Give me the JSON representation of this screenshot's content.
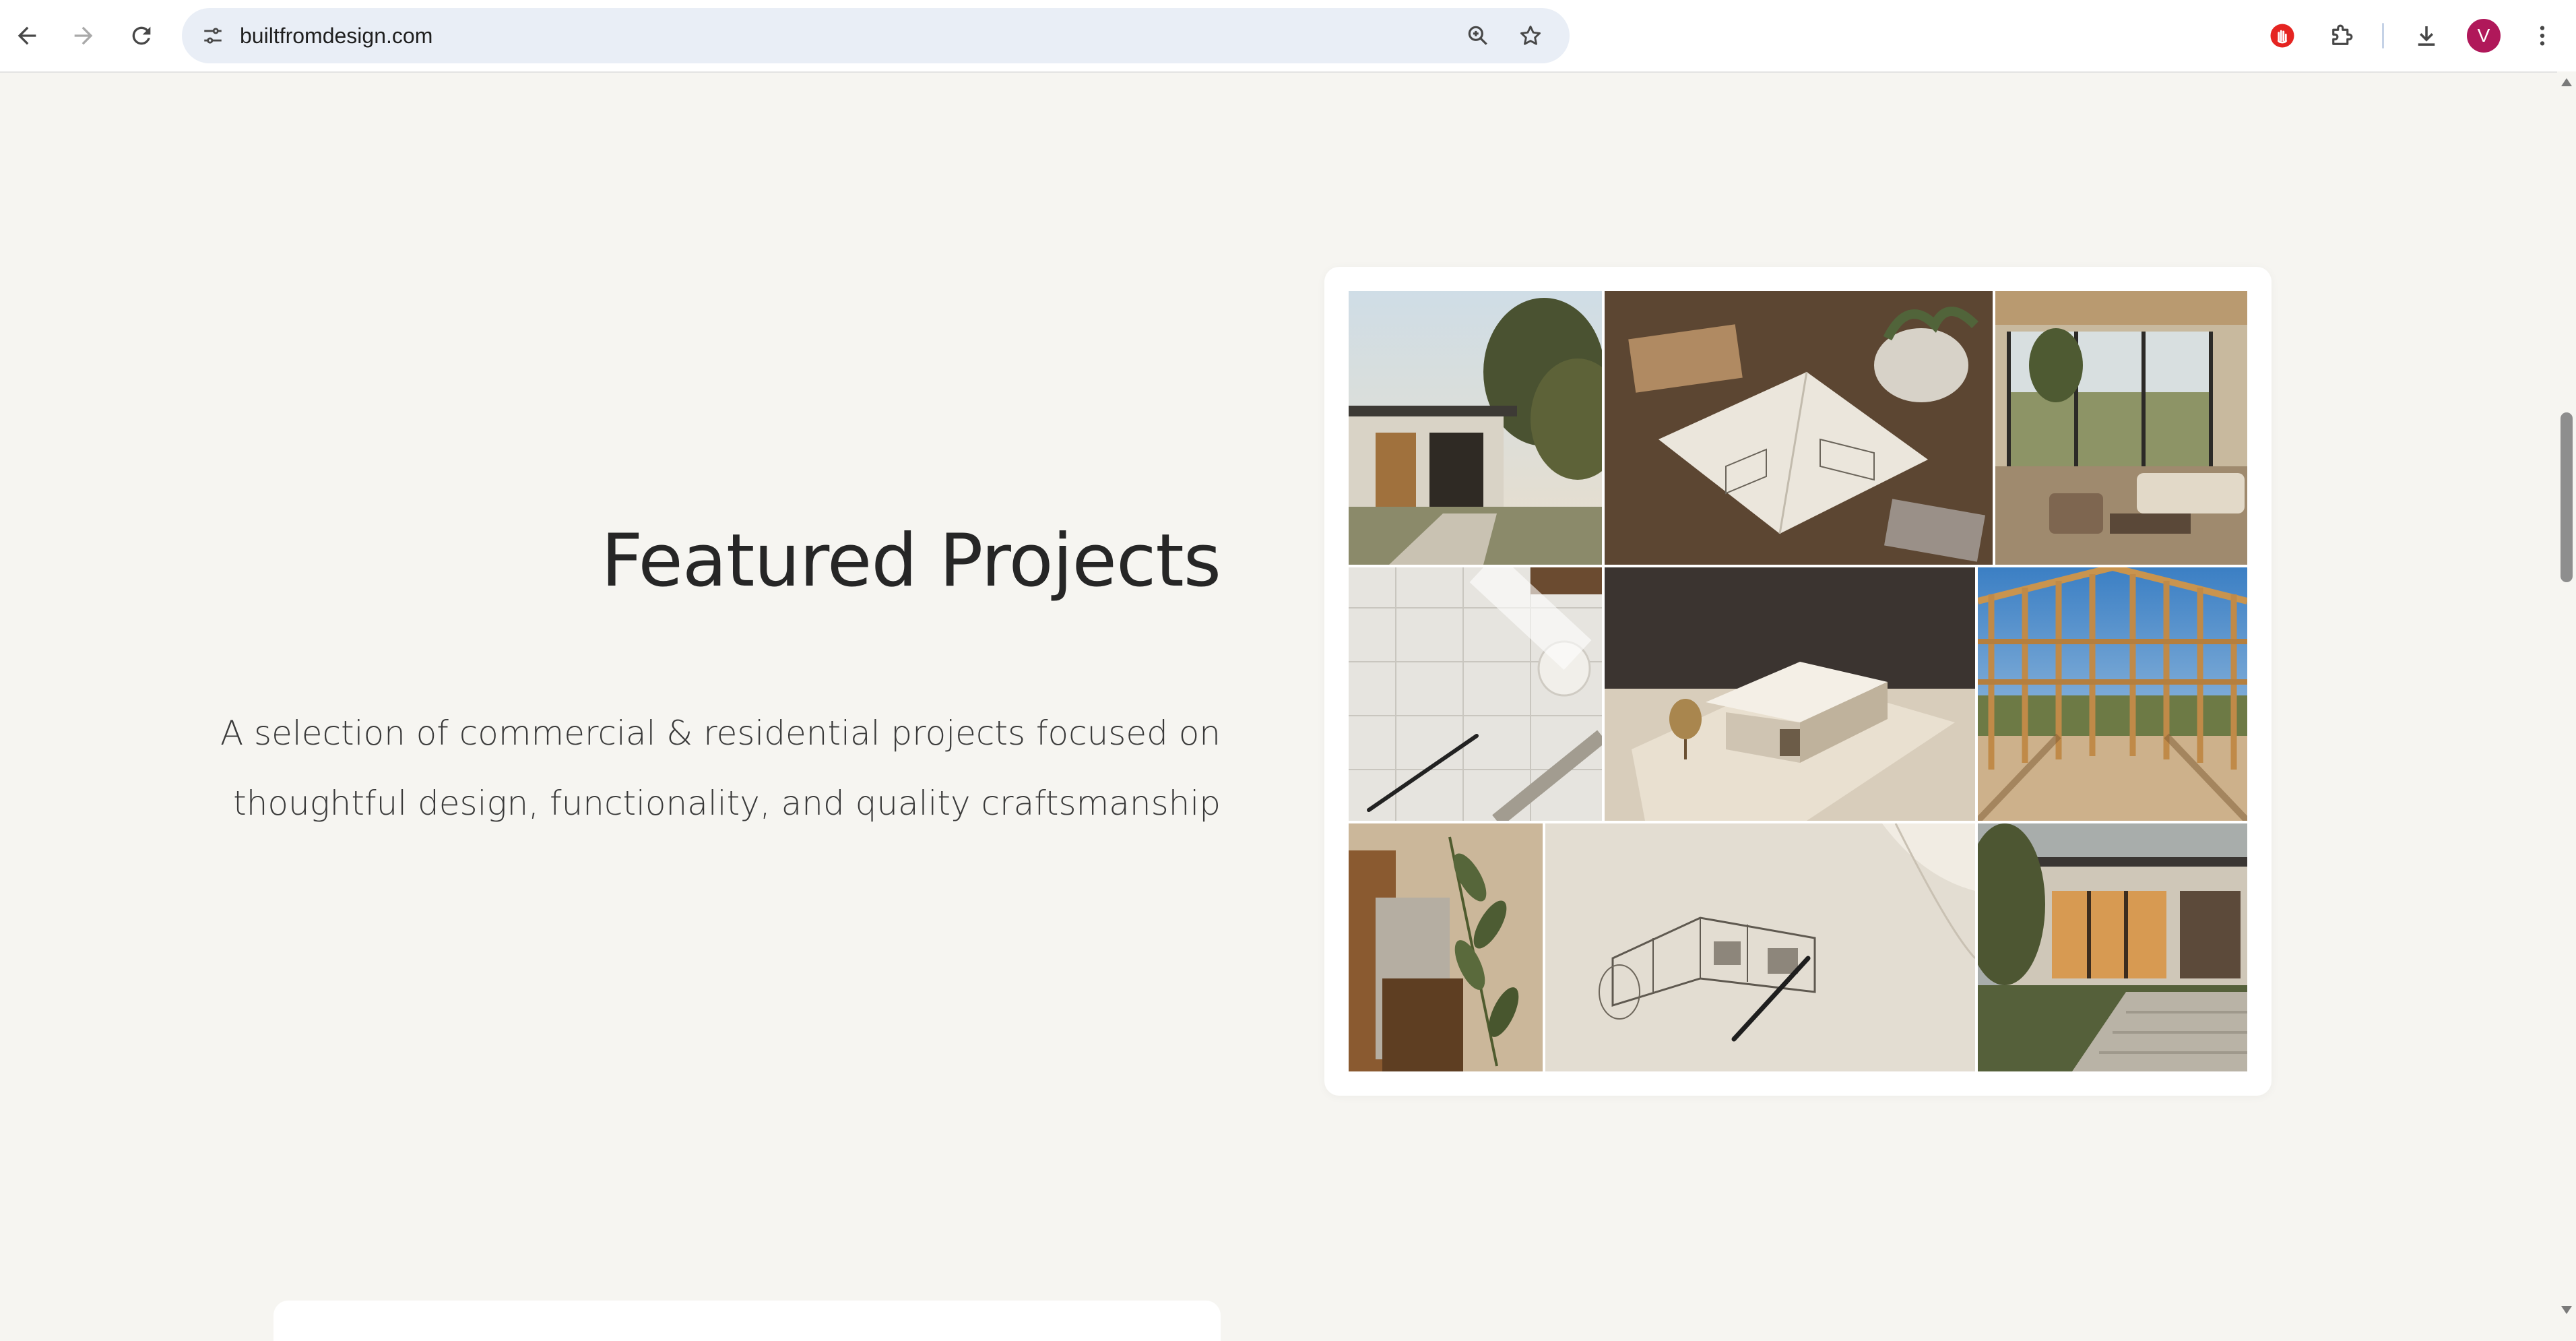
{
  "browser": {
    "url": "builtfromdesign.com",
    "profile_initial": "V",
    "profile_color": "#b0185a",
    "icons": {
      "back": "arrow-left-icon",
      "forward": "arrow-right-icon",
      "reload": "reload-icon",
      "site_info": "tune-icon",
      "zoom": "zoom-icon",
      "bookmark": "star-icon",
      "extension_red": "hand-stop-icon",
      "extensions": "puzzle-icon",
      "downloads": "download-icon",
      "menu": "kebab-menu-icon"
    }
  },
  "section": {
    "title": "Featured Projects",
    "description": "A selection of commercial & residential projects focused on thoughtful design, functionality, and quality craftsmanship"
  },
  "gallery": {
    "images": [
      {
        "subject": "modern house exterior with trees"
      },
      {
        "subject": "open sketchbook with architectural drawing on table"
      },
      {
        "subject": "living room interior with glass walls"
      },
      {
        "subject": "blueprints with pen and ruler"
      },
      {
        "subject": "white architectural scale model"
      },
      {
        "subject": "timber frame construction"
      },
      {
        "subject": "material samples with olive branch"
      },
      {
        "subject": "architectural pencil sketch with pen"
      },
      {
        "subject": "house exterior at dusk with warm lights"
      }
    ]
  },
  "colors": {
    "page_background": "#f6f5f1",
    "heading_text": "#262626",
    "body_text": "#3a3a3a",
    "card_background": "#ffffff"
  }
}
